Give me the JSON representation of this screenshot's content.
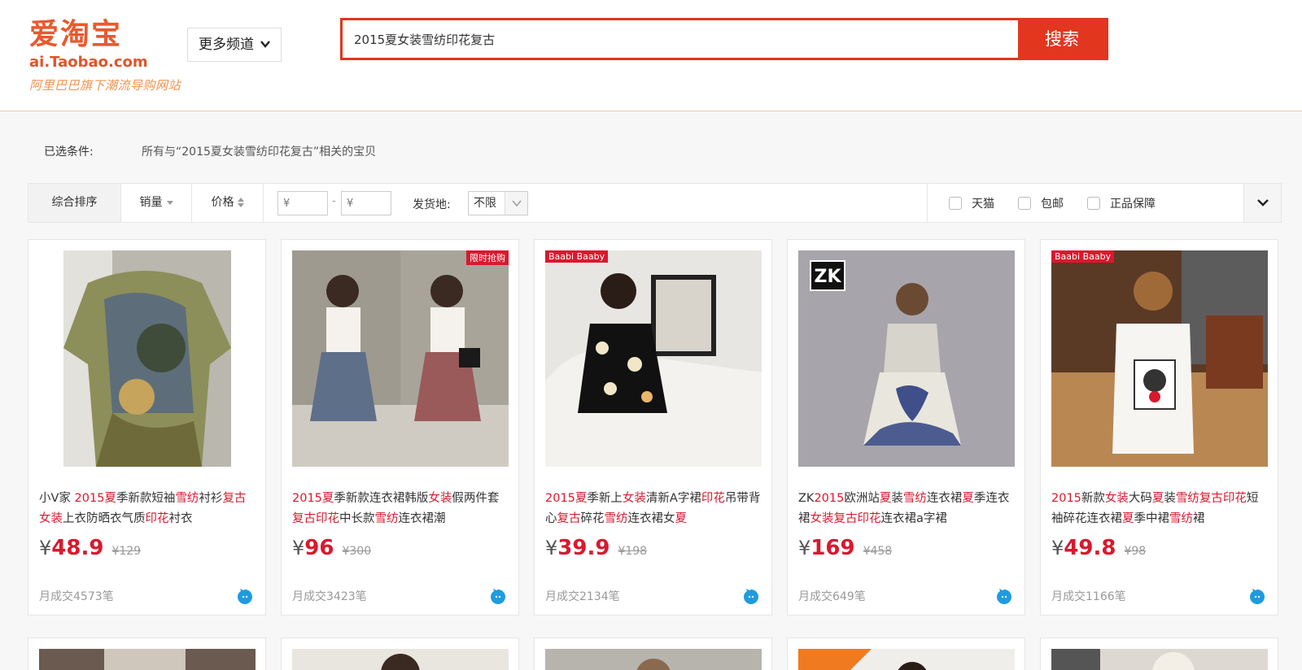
{
  "logo": {
    "cn": "爱淘宝",
    "en": "ai.Taobao.com",
    "slogan": "阿里巴巴旗下潮流导购网站"
  },
  "channel_button": "更多频道",
  "search": {
    "query": "2015夏女装雪纺印花复古",
    "button": "搜索"
  },
  "conditions": {
    "label": "已选条件:",
    "text": "所有与“2015夏女装雪纺印花复古”相关的宝贝"
  },
  "sort": {
    "default": "综合排序",
    "sales": "销量",
    "price": "价格"
  },
  "price_range": {
    "min_placeholder": "¥",
    "max_placeholder": "¥",
    "dash": "-"
  },
  "ship_from": {
    "label": "发货地:",
    "value": "不限"
  },
  "checkboxes": [
    "天猫",
    "包邮",
    "正品保障"
  ],
  "currency": "¥",
  "products": [
    {
      "title_parts": [
        [
          "小V家 ",
          false
        ],
        [
          "2015",
          true
        ],
        [
          "夏",
          true
        ],
        [
          "季新款短袖",
          false
        ],
        [
          "雪纺",
          true
        ],
        [
          "衬衫",
          false
        ],
        [
          "复古",
          true
        ],
        [
          "女装",
          true
        ],
        [
          "上衣防晒衣气质",
          false
        ],
        [
          "印花",
          true
        ],
        [
          "衬衣",
          false
        ]
      ],
      "price": "48.9",
      "orig_price": "¥129",
      "sales": "月成交4573笔",
      "badge_left": "",
      "badge_right": ""
    },
    {
      "title_parts": [
        [
          "2015",
          true
        ],
        [
          "夏",
          true
        ],
        [
          "季新款连衣裙韩版",
          false
        ],
        [
          "女装",
          true
        ],
        [
          "假两件套",
          false
        ],
        [
          "复古",
          true
        ],
        [
          "印花",
          true
        ],
        [
          "中长款",
          false
        ],
        [
          "雪纺",
          true
        ],
        [
          "连衣裙潮",
          false
        ]
      ],
      "price": "96",
      "orig_price": "¥300",
      "sales": "月成交3423笔",
      "badge_left": "",
      "badge_right": "限时抢购"
    },
    {
      "title_parts": [
        [
          "2015",
          true
        ],
        [
          "夏",
          true
        ],
        [
          "季新上",
          false
        ],
        [
          "女装",
          true
        ],
        [
          "清新A字裙",
          false
        ],
        [
          "印花",
          true
        ],
        [
          "吊带背心",
          false
        ],
        [
          "复古",
          true
        ],
        [
          "碎花",
          false
        ],
        [
          "雪纺",
          true
        ],
        [
          "连衣裙女",
          false
        ],
        [
          "夏",
          true
        ]
      ],
      "price": "39.9",
      "orig_price": "¥198",
      "sales": "月成交2134笔",
      "badge_left": "Baabi Baaby",
      "badge_right": ""
    },
    {
      "title_parts": [
        [
          "ZK",
          false
        ],
        [
          "2015",
          true
        ],
        [
          "欧洲站",
          false
        ],
        [
          "夏",
          true
        ],
        [
          "装",
          false
        ],
        [
          "雪纺",
          true
        ],
        [
          "连衣裙",
          false
        ],
        [
          "夏",
          true
        ],
        [
          "季连衣裙",
          false
        ],
        [
          "女装",
          true
        ],
        [
          "复古",
          true
        ],
        [
          "印花",
          true
        ],
        [
          "连衣裙a字裙",
          false
        ]
      ],
      "price": "169",
      "orig_price": "¥458",
      "sales": "月成交649笔",
      "badge_left": "",
      "badge_right": "",
      "logo_mark": "ZK"
    },
    {
      "title_parts": [
        [
          "2015",
          true
        ],
        [
          "新款",
          false
        ],
        [
          "女装",
          true
        ],
        [
          "大码",
          false
        ],
        [
          "夏",
          true
        ],
        [
          "装",
          false
        ],
        [
          "雪纺",
          true
        ],
        [
          "复古",
          true
        ],
        [
          "印花",
          true
        ],
        [
          "短袖碎花连衣裙",
          false
        ],
        [
          "夏",
          true
        ],
        [
          "季中裙",
          false
        ],
        [
          "雪纺",
          true
        ],
        [
          "裙",
          false
        ]
      ],
      "price": "49.8",
      "orig_price": "¥98",
      "sales": "月成交1166笔",
      "badge_left": "Baabi Baaby",
      "badge_right": ""
    }
  ],
  "colors": {
    "brand": "#e2361e",
    "highlight": "#d8192e",
    "logo": "#e8592e"
  }
}
